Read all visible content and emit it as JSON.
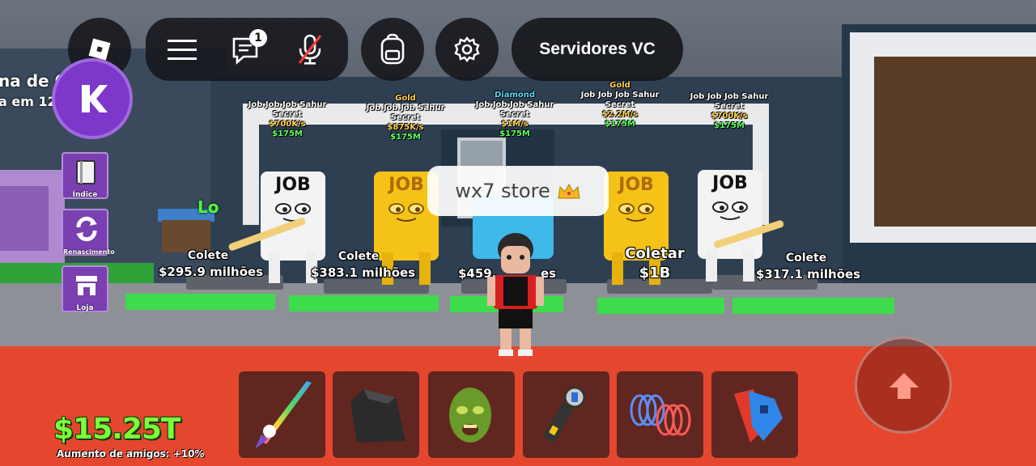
{
  "topbar": {
    "chat_badge": "1",
    "servers_label": "Servidores VC"
  },
  "left_sign": {
    "line1": "na de C",
    "line2": "a em 12",
    "lo": "Lo"
  },
  "sidebar": {
    "items": [
      {
        "label": "Índice",
        "icon": "book-icon"
      },
      {
        "label": "Renascimento",
        "icon": "refresh-icon"
      },
      {
        "label": "Loja",
        "icon": "shop-icon"
      }
    ]
  },
  "overhead_labels": [
    {
      "rarity": "",
      "name": "Job Job Job Sahur",
      "tier": "Secret",
      "rate": "$700K/s",
      "price": "$175M"
    },
    {
      "rarity": "Gold",
      "name": "Job Job Job Sahur",
      "tier": "Secret",
      "rate": "$875K/s",
      "price": "$175M"
    },
    {
      "rarity": "Diamond",
      "name": "Job Job Job Sahur",
      "tier": "Secret",
      "rate": "$1M/s",
      "price": "$175M"
    },
    {
      "rarity": "Gold",
      "name": "Job Job Job Sahur",
      "tier": "Secret",
      "rate": "$2.2M/s",
      "price": "$175M"
    },
    {
      "rarity": "",
      "name": "Job Job Job Sahur",
      "tier": "Secret",
      "rate": "$700K/s",
      "price": "$175M"
    }
  ],
  "job_tag": "JOB",
  "collect_labels": [
    {
      "title": "Colete",
      "amount": "$295.9 milhões"
    },
    {
      "title": "Colete",
      "amount": "$383.1 milhões"
    },
    {
      "title": "",
      "amount": "$459."
    },
    {
      "title": "Coletar",
      "amount": "$1B"
    },
    {
      "title": "Colete",
      "amount": "$317.1 milhões"
    }
  ],
  "collect_tail": "es",
  "store_bubble": "wx7 store",
  "hotbar": [
    "rainbow-unicorn-sword",
    "black-cape",
    "green-zombie-mask",
    "grapple-hook",
    "spring-coils",
    "blue-red-cross-tool"
  ],
  "money": "$15.25T",
  "friends_bonus": "Aumento de amigos: +10%",
  "colors": {
    "money": "#7dff3a",
    "rarity_gold": "#ffd24a",
    "rarity_diamond": "#5ad9ff",
    "rate": "#ffd24a",
    "price": "#5dff5d",
    "floor": "#e5472e",
    "sidebar": "#7a3fb0"
  }
}
